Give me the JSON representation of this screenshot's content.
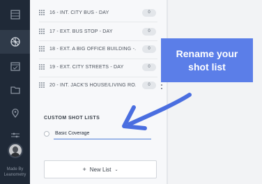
{
  "rail": {
    "icons": [
      "list-icon",
      "film-reel-icon",
      "calendar-icon",
      "folder-icon",
      "location-pin-icon",
      "sliders-icon"
    ],
    "made_by_line1": "Made By",
    "made_by_line2": "Leanometry"
  },
  "shot_rows": [
    {
      "label": "16 - INT. CITY BUS - DAY",
      "count": "0"
    },
    {
      "label": "17 - EXT. BUS STOP - DAY",
      "count": "0"
    },
    {
      "label": "18 - EXT. A BIG OFFICE BUILDING -...",
      "count": "0"
    },
    {
      "label": "19 - EXT. CITY STREETS - DAY",
      "count": "0"
    },
    {
      "label": "20 - INT. JACK'S HOUSE/LIVING RO...",
      "count": "0"
    }
  ],
  "custom_lists": {
    "title": "CUSTOM SHOT LISTS",
    "input_value": "Basic Coverage"
  },
  "new_list": {
    "plus": "+",
    "label": "New List",
    "chevron": "⌄"
  },
  "callout": {
    "line1": "Rename your",
    "line2": "shot list",
    "color": "#5b7ee8"
  }
}
